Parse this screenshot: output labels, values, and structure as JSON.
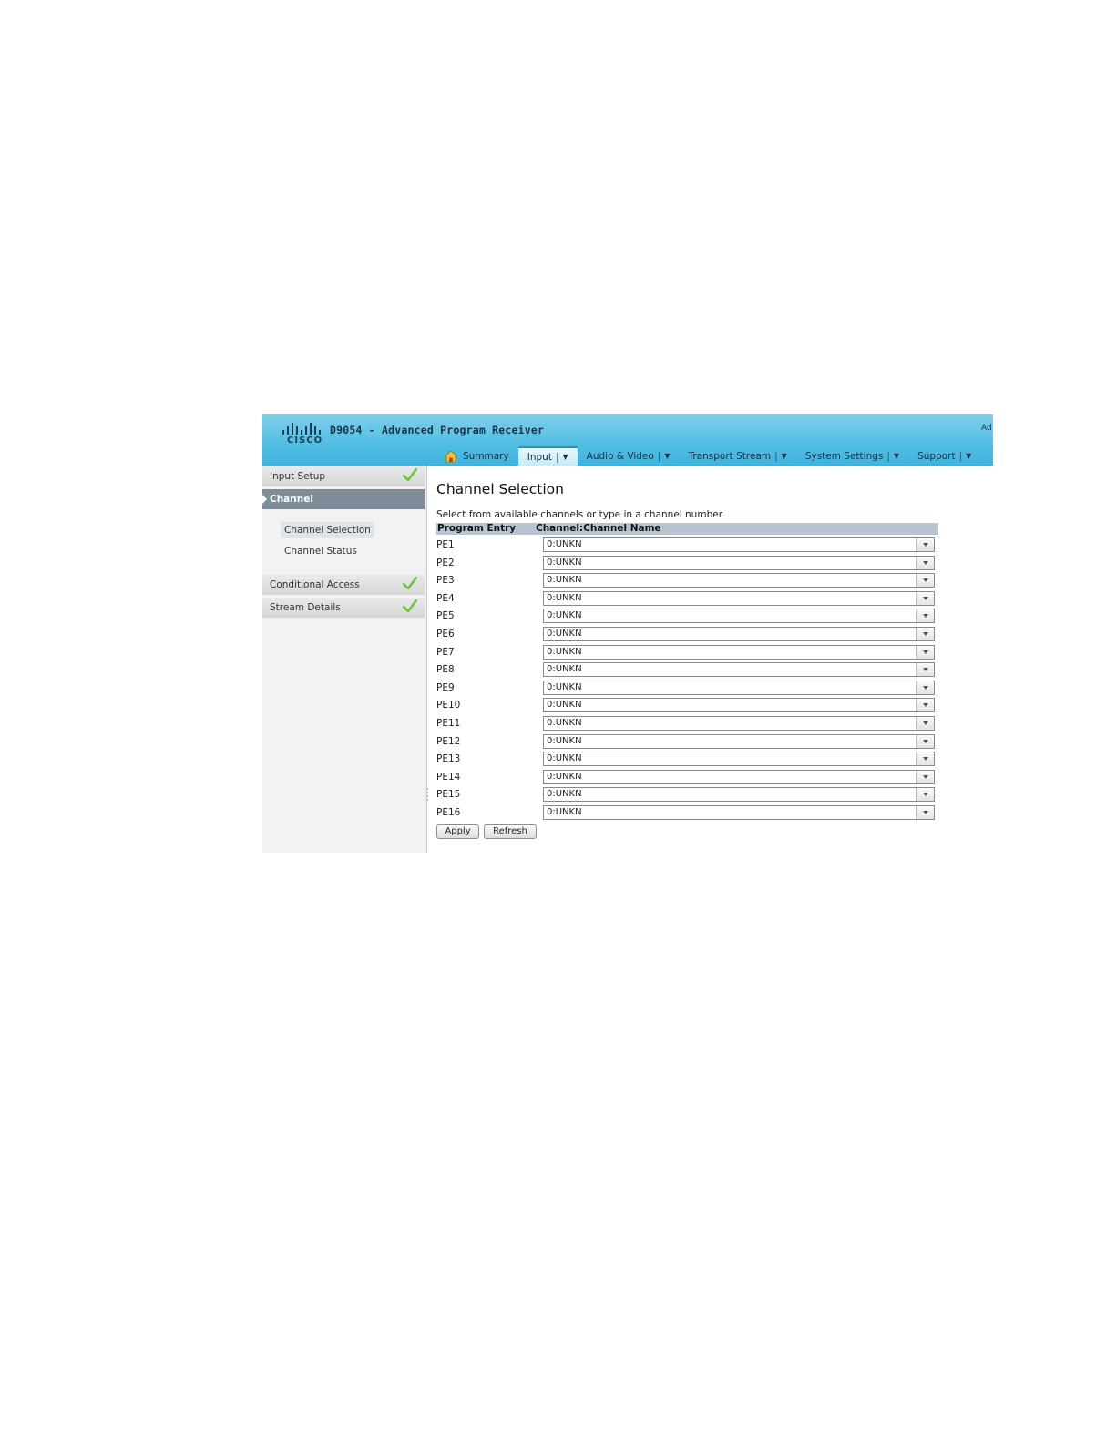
{
  "header": {
    "logo_text": "CISCO",
    "title": "D9054 - Advanced Program Receiver",
    "user_cut": "Ad"
  },
  "nav": [
    {
      "label": "Summary",
      "icon": "home-icon",
      "active": false
    },
    {
      "label": "Input",
      "active": true
    },
    {
      "label": "Audio & Video",
      "active": false
    },
    {
      "label": "Transport Stream",
      "active": false
    },
    {
      "label": "System Settings",
      "active": false
    },
    {
      "label": "Support",
      "active": false
    }
  ],
  "sidebar": {
    "sections": [
      {
        "label": "Input Setup",
        "checked": true
      },
      {
        "label": "Channel",
        "active": true
      },
      {
        "label": "Conditional Access",
        "checked": true
      },
      {
        "label": "Stream Details",
        "checked": true
      }
    ],
    "sub_items": [
      {
        "label": "Channel Selection",
        "active": true
      },
      {
        "label": "Channel Status",
        "active": false
      }
    ]
  },
  "main": {
    "title": "Channel Selection",
    "instruction": "Select from available channels or type in a channel number",
    "columns": [
      "Program Entry",
      "Channel:Channel Name"
    ],
    "rows": [
      {
        "entry": "PE1",
        "value": "0:UNKN"
      },
      {
        "entry": "PE2",
        "value": "0:UNKN"
      },
      {
        "entry": "PE3",
        "value": "0:UNKN"
      },
      {
        "entry": "PE4",
        "value": "0:UNKN"
      },
      {
        "entry": "PE5",
        "value": "0:UNKN"
      },
      {
        "entry": "PE6",
        "value": "0:UNKN"
      },
      {
        "entry": "PE7",
        "value": "0:UNKN"
      },
      {
        "entry": "PE8",
        "value": "0:UNKN"
      },
      {
        "entry": "PE9",
        "value": "0:UNKN"
      },
      {
        "entry": "PE10",
        "value": "0:UNKN"
      },
      {
        "entry": "PE11",
        "value": "0:UNKN"
      },
      {
        "entry": "PE12",
        "value": "0:UNKN"
      },
      {
        "entry": "PE13",
        "value": "0:UNKN"
      },
      {
        "entry": "PE14",
        "value": "0:UNKN"
      },
      {
        "entry": "PE15",
        "value": "0:UNKN"
      },
      {
        "entry": "PE16",
        "value": "0:UNKN"
      }
    ],
    "buttons": {
      "apply": "Apply",
      "refresh": "Refresh"
    }
  },
  "colors": {
    "header_blue": "#55bfe4",
    "sidebar_active": "#7f8c99",
    "table_header": "#b7c5d2",
    "check_green": "#6fbf3a"
  }
}
